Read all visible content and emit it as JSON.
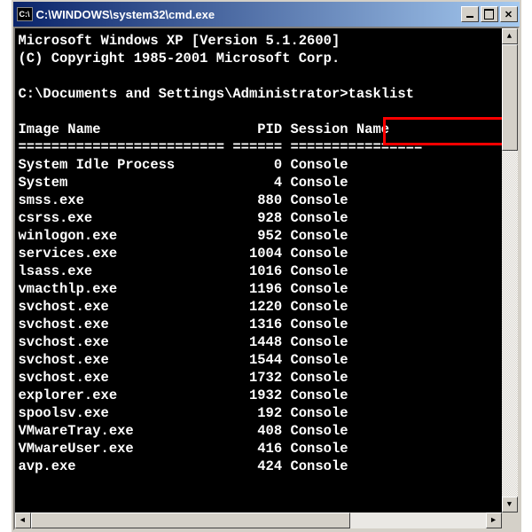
{
  "window": {
    "title": "C:\\WINDOWS\\system32\\cmd.exe",
    "icon_label": "C:\\"
  },
  "console": {
    "banner_line1": "Microsoft Windows XP [Version 5.1.2600]",
    "banner_line2": "(C) Copyright 1985-2001 Microsoft Corp.",
    "prompt": "C:\\Documents and Settings\\Administrator>",
    "command": "tasklist",
    "header_image_name": "Image Name",
    "header_pid": "PID",
    "header_session_name": "Session Name",
    "divider_image": "=========================",
    "divider_pid": "======",
    "divider_session": "================",
    "rows": [
      {
        "name": "System Idle Process",
        "pid": "0",
        "session": "Console"
      },
      {
        "name": "System",
        "pid": "4",
        "session": "Console"
      },
      {
        "name": "smss.exe",
        "pid": "880",
        "session": "Console"
      },
      {
        "name": "csrss.exe",
        "pid": "928",
        "session": "Console"
      },
      {
        "name": "winlogon.exe",
        "pid": "952",
        "session": "Console"
      },
      {
        "name": "services.exe",
        "pid": "1004",
        "session": "Console"
      },
      {
        "name": "lsass.exe",
        "pid": "1016",
        "session": "Console"
      },
      {
        "name": "vmacthlp.exe",
        "pid": "1196",
        "session": "Console"
      },
      {
        "name": "svchost.exe",
        "pid": "1220",
        "session": "Console"
      },
      {
        "name": "svchost.exe",
        "pid": "1316",
        "session": "Console"
      },
      {
        "name": "svchost.exe",
        "pid": "1448",
        "session": "Console"
      },
      {
        "name": "svchost.exe",
        "pid": "1544",
        "session": "Console"
      },
      {
        "name": "svchost.exe",
        "pid": "1732",
        "session": "Console"
      },
      {
        "name": "explorer.exe",
        "pid": "1932",
        "session": "Console"
      },
      {
        "name": "spoolsv.exe",
        "pid": "192",
        "session": "Console"
      },
      {
        "name": "VMwareTray.exe",
        "pid": "408",
        "session": "Console"
      },
      {
        "name": "VMwareUser.exe",
        "pid": "416",
        "session": "Console"
      },
      {
        "name": "avp.exe",
        "pid": "424",
        "session": "Console"
      }
    ]
  },
  "highlight": {
    "color": "#ff0000"
  }
}
